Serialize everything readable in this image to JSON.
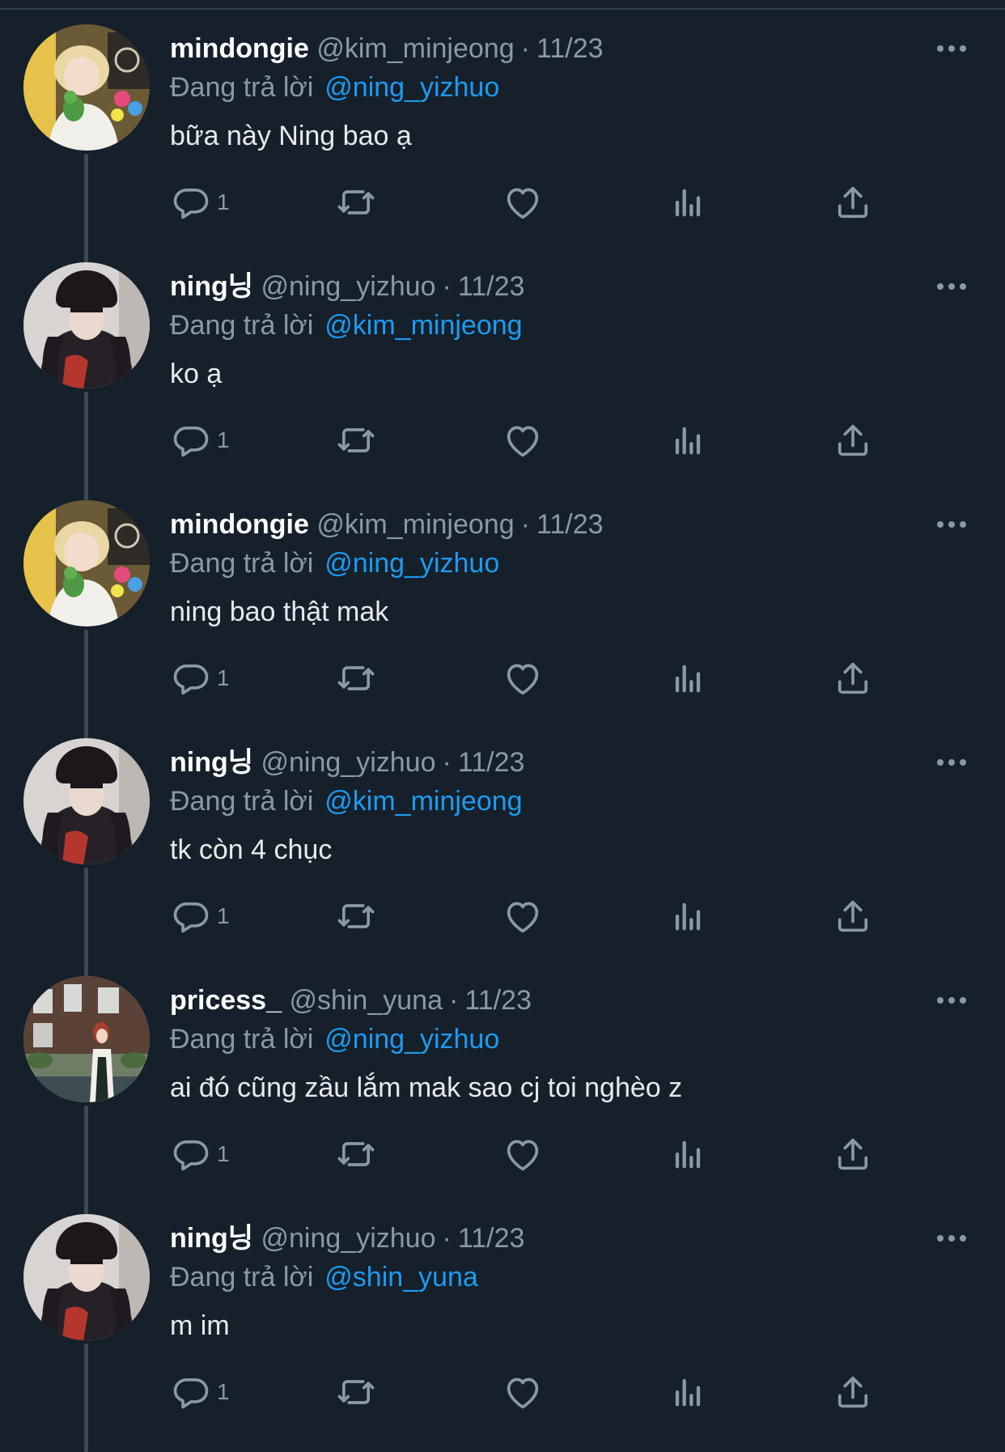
{
  "reply_prefix": "Đang trả lời",
  "colors": {
    "background": "#15202b",
    "link": "#1d9bf0",
    "muted": "#8b98a5",
    "text": "#e7e9ea"
  },
  "tweets": [
    {
      "name": "mindongie",
      "handle": "@kim_minjeong",
      "date": "11/23",
      "reply_to": "@ning_yizhuo",
      "text": "bữa này Ning bao ạ",
      "reply_count": "1",
      "avatar": "avatar-blonde"
    },
    {
      "name": "ning닝",
      "handle": "@ning_yizhuo",
      "date": "11/23",
      "reply_to": "@kim_minjeong",
      "text": "ko ạ",
      "reply_count": "1",
      "avatar": "avatar-dark-hat"
    },
    {
      "name": "mindongie",
      "handle": "@kim_minjeong",
      "date": "11/23",
      "reply_to": "@ning_yizhuo",
      "text": "ning bao thật mak",
      "reply_count": "1",
      "avatar": "avatar-blonde"
    },
    {
      "name": "ning닝",
      "handle": "@ning_yizhuo",
      "date": "11/23",
      "reply_to": "@kim_minjeong",
      "text": "tk còn 4 chục",
      "reply_count": "1",
      "avatar": "avatar-dark-hat"
    },
    {
      "name": "pricess_",
      "handle": "@shin_yuna",
      "date": "11/23",
      "reply_to": "@ning_yizhuo",
      "text": "ai đó cũng zầu lắm mak sao cj toi nghèo z",
      "reply_count": "1",
      "avatar": "avatar-street"
    },
    {
      "name": "ning닝",
      "handle": "@ning_yizhuo",
      "date": "11/23",
      "reply_to": "@shin_yuna",
      "text": "m im",
      "reply_count": "1",
      "avatar": "avatar-dark-hat"
    }
  ]
}
